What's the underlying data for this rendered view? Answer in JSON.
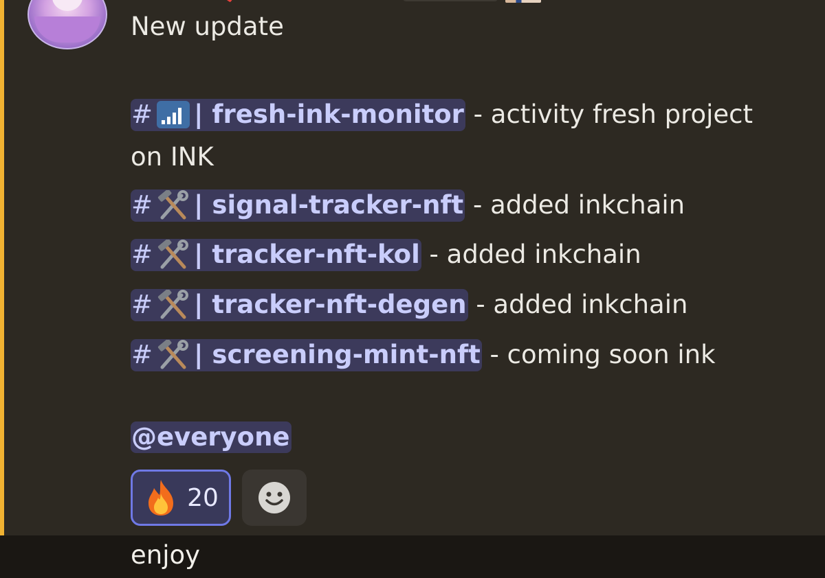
{
  "message": {
    "heading": "New update",
    "channels": [
      {
        "hash": "#",
        "icon": "signal-bars-icon",
        "sep": "|",
        "name": "fresh-ink-monitor",
        "desc": " - activity fresh project"
      },
      {
        "hash": "#",
        "icon": "hammer-wrench-icon",
        "sep": "|",
        "name": "signal-tracker-nft",
        "desc": " - added inkchain"
      },
      {
        "hash": "#",
        "icon": "hammer-wrench-icon",
        "sep": "|",
        "name": "tracker-nft-kol",
        "desc": " - added inkchain"
      },
      {
        "hash": "#",
        "icon": "hammer-wrench-icon",
        "sep": "|",
        "name": "tracker-nft-degen",
        "desc": " - added inkchain"
      },
      {
        "hash": "#",
        "icon": "hammer-wrench-icon",
        "sep": "|",
        "name": "screening-mint-nft",
        "desc": " - coming soon ink"
      }
    ],
    "wrap_text": "on INK",
    "everyone": "@everyone"
  },
  "reactions": [
    {
      "emoji": "fire-icon",
      "count": "20"
    },
    {
      "emoji": "add-reaction-smiley-icon"
    }
  ],
  "next_message": {
    "text": "enjoy"
  },
  "colors": {
    "background": "#2d2922",
    "accent_bar": "#f0b232",
    "mention_bg": "#3c3a5b",
    "mention_text": "#c9cdfb",
    "reaction_border": "#6f79e6"
  }
}
